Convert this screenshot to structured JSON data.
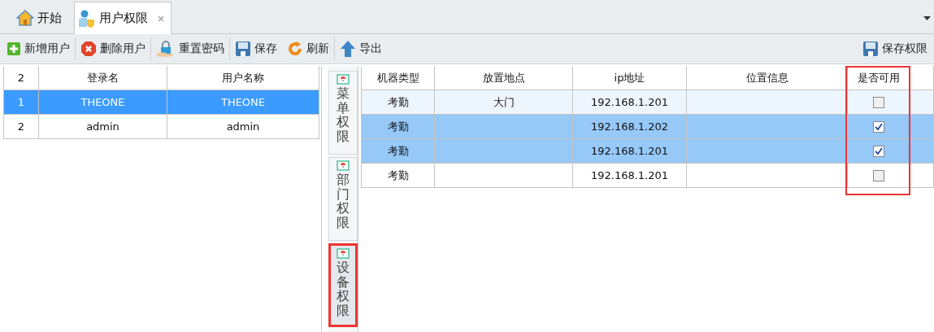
{
  "tabs": [
    {
      "label": "开始",
      "selected": false
    },
    {
      "label": "用户权限",
      "selected": true
    }
  ],
  "toolbar": [
    {
      "label": "新增用户"
    },
    {
      "label": "删除用户"
    },
    {
      "label": "重置密码"
    },
    {
      "label": "保存"
    },
    {
      "label": "刷新"
    },
    {
      "label": "导出"
    }
  ],
  "toolbar_right": {
    "label": "保存权限"
  },
  "user_table": {
    "count": "2",
    "columns": [
      "登录名",
      "用户名称"
    ],
    "rows": [
      {
        "number": "1",
        "cells": [
          "THEONE",
          "THEONE"
        ],
        "selected": true
      },
      {
        "number": "2",
        "cells": [
          "admin",
          "admin"
        ],
        "selected": false
      }
    ]
  },
  "side_tabs": [
    {
      "label": "菜单权限",
      "selected": false,
      "highlighted": false
    },
    {
      "label": "部门权限",
      "selected": false,
      "highlighted": false
    },
    {
      "label": "设备权限",
      "selected": true,
      "highlighted": true
    }
  ],
  "device_table": {
    "columns": [
      {
        "label": "机器类型",
        "highlighted": false
      },
      {
        "label": "放置地点",
        "highlighted": false
      },
      {
        "label": "ip地址",
        "highlighted": false
      },
      {
        "label": "位置信息",
        "highlighted": false
      },
      {
        "label": "是否可用",
        "highlighted": true
      }
    ],
    "rows": [
      {
        "type": "考勤",
        "location": "大门",
        "ip": "192.168.1.201",
        "selected": false,
        "hovered": true,
        "enabled": false
      },
      {
        "type": "考勤",
        "ip": "192.168.1.202",
        "selected": true,
        "hovered": false,
        "enabled": true
      },
      {
        "type": "考勤",
        "ip": "192.168.1.201",
        "selected": true,
        "hovered": false,
        "enabled": true
      },
      {
        "type": "考勤",
        "ip": "192.168.1.201",
        "selected": false,
        "hovered": false,
        "enabled": false
      }
    ]
  }
}
